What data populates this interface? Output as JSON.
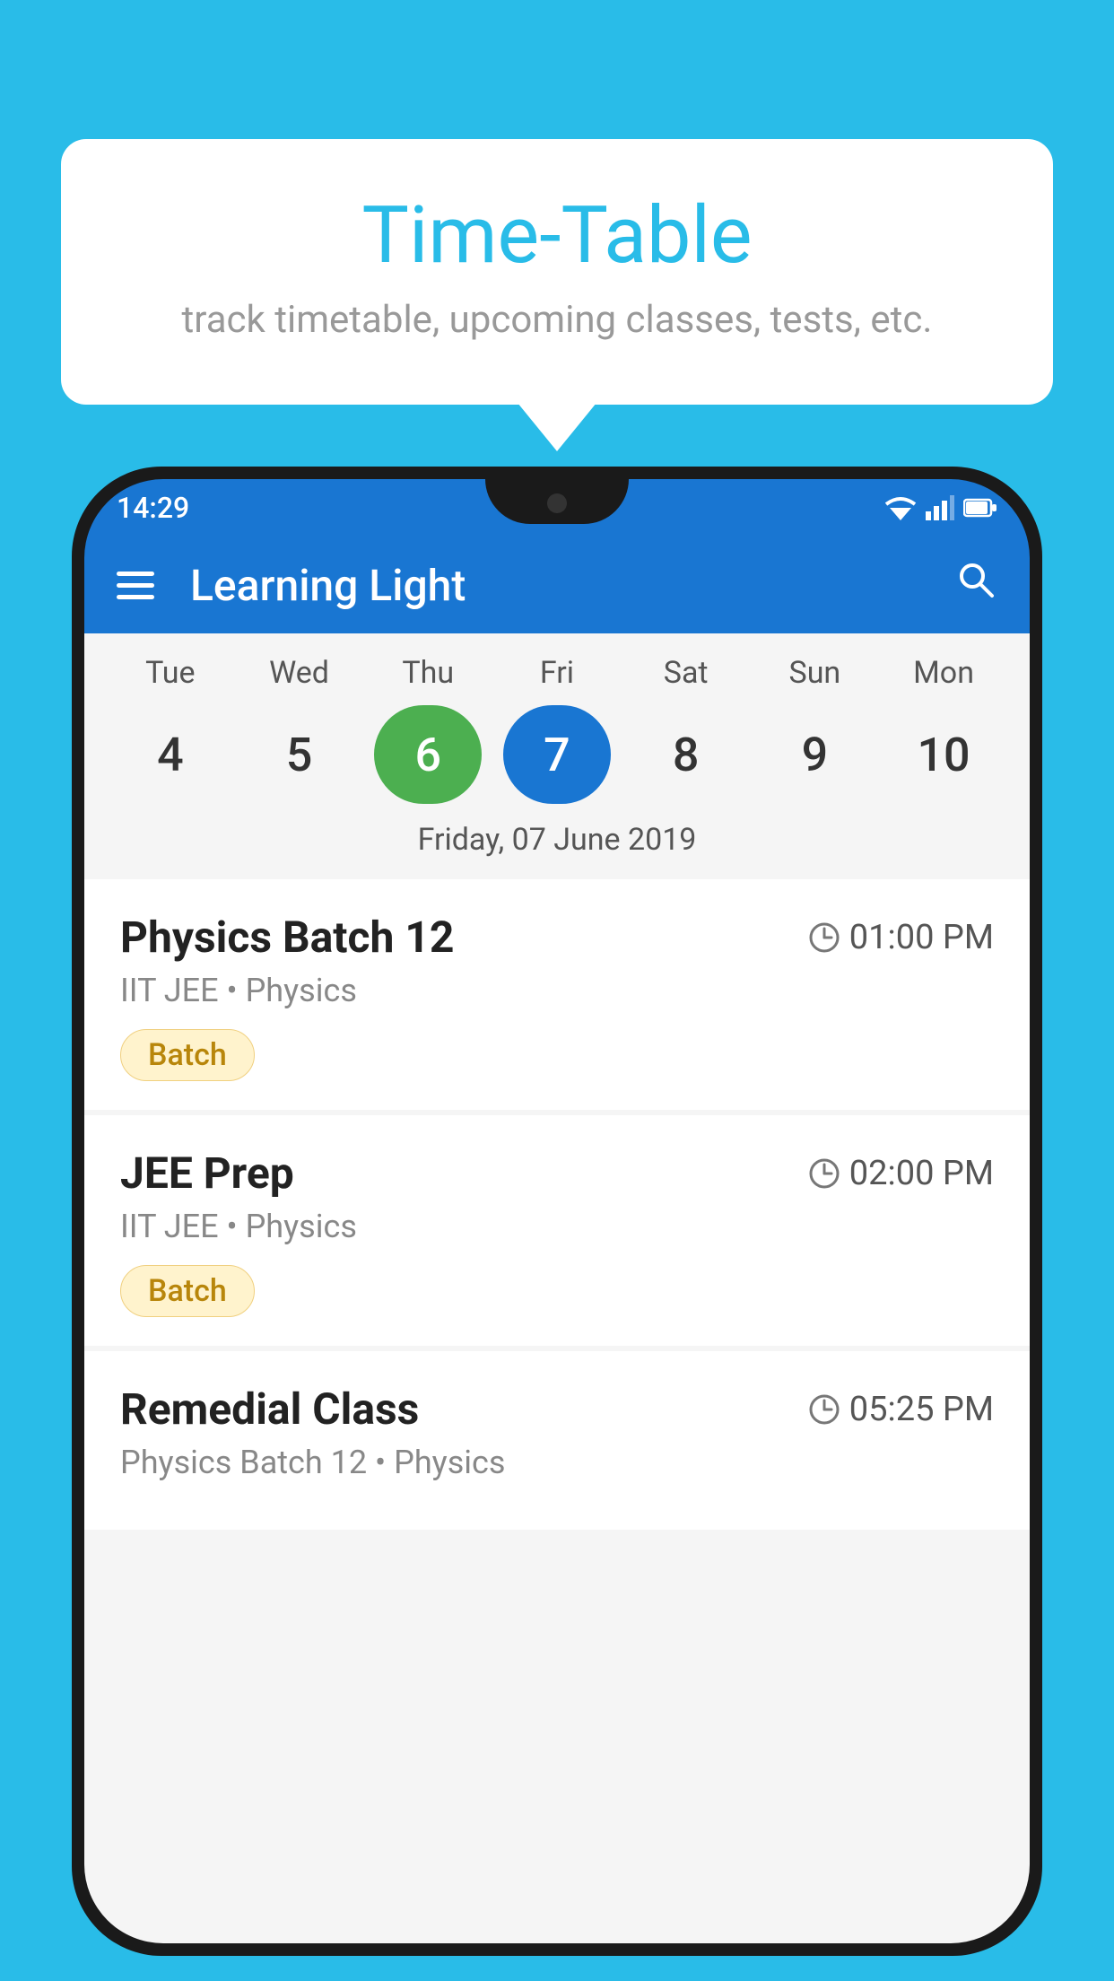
{
  "background_color": "#29bce8",
  "speech_bubble": {
    "title": "Time-Table",
    "subtitle": "track timetable, upcoming classes, tests, etc."
  },
  "phone": {
    "status_bar": {
      "time": "14:29"
    },
    "app_bar": {
      "title": "Learning Light"
    },
    "calendar": {
      "day_headers": [
        "Tue",
        "Wed",
        "Thu",
        "Fri",
        "Sat",
        "Sun",
        "Mon"
      ],
      "day_numbers": [
        {
          "number": "4",
          "state": "normal"
        },
        {
          "number": "5",
          "state": "normal"
        },
        {
          "number": "6",
          "state": "today"
        },
        {
          "number": "7",
          "state": "selected"
        },
        {
          "number": "8",
          "state": "normal"
        },
        {
          "number": "9",
          "state": "normal"
        },
        {
          "number": "10",
          "state": "normal"
        }
      ],
      "selected_date_label": "Friday, 07 June 2019"
    },
    "schedule_items": [
      {
        "title": "Physics Batch 12",
        "time": "01:00 PM",
        "subtitle": "IIT JEE • Physics",
        "badge": "Batch"
      },
      {
        "title": "JEE Prep",
        "time": "02:00 PM",
        "subtitle": "IIT JEE • Physics",
        "badge": "Batch"
      },
      {
        "title": "Remedial Class",
        "time": "05:25 PM",
        "subtitle": "Physics Batch 12 • Physics",
        "badge": ""
      }
    ]
  }
}
